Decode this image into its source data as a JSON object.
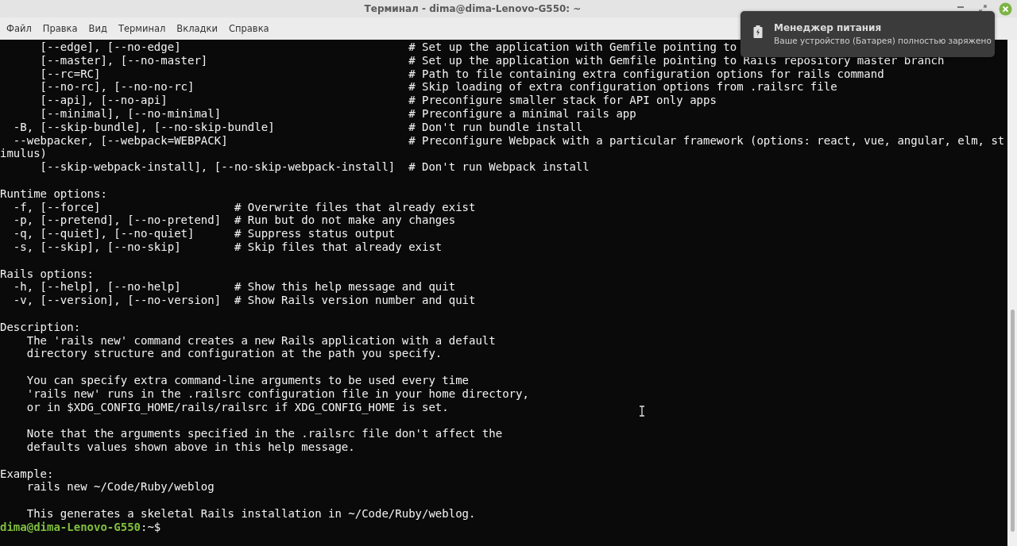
{
  "window": {
    "title": "Терминал - dima@dima-Lenovo-G550: ~"
  },
  "menu": [
    {
      "label": "Файл"
    },
    {
      "label": "Правка"
    },
    {
      "label": "Вид"
    },
    {
      "label": "Терминал"
    },
    {
      "label": "Вкладки"
    },
    {
      "label": "Справка"
    }
  ],
  "terminal": {
    "blocks": [
      {
        "lines": [
          {
            "kind": "option",
            "option": "      [--edge], [--no-edge]",
            "comment": "# Set up the application with Gemfile pointing to"
          },
          {
            "kind": "option",
            "option": "      [--master], [--no-master]",
            "comment": "# Set up the application with Gemfile pointing to Rails repository master branch"
          },
          {
            "kind": "option",
            "option": "      [--rc=RC]",
            "comment": "# Path to file containing extra configuration options for rails command"
          },
          {
            "kind": "option",
            "option": "      [--no-rc], [--no-no-rc]",
            "comment": "# Skip loading of extra configuration options from .railsrc file"
          },
          {
            "kind": "option",
            "option": "      [--api], [--no-api]",
            "comment": "# Preconfigure smaller stack for API only apps"
          },
          {
            "kind": "option",
            "option": "      [--minimal], [--no-minimal]",
            "comment": "# Preconfigure a minimal rails app"
          },
          {
            "kind": "option",
            "option": "  -B, [--skip-bundle], [--no-skip-bundle]",
            "comment": "# Don't run bundle install"
          },
          {
            "kind": "option",
            "option": "  --webpacker, [--webpack=WEBPACK]",
            "comment": "# Preconfigure Webpack with a particular framework (options: react, vue, angular, elm, st"
          },
          {
            "kind": "text",
            "text": "imulus)"
          },
          {
            "kind": "option",
            "option": "      [--skip-webpack-install], [--no-skip-webpack-install]",
            "comment": "# Don't run Webpack install"
          }
        ]
      },
      {
        "lines": [
          {
            "kind": "text",
            "text": "Runtime options:"
          },
          {
            "kind": "option",
            "option": "  -f, [--force]",
            "comment": "# Overwrite files that already exist"
          },
          {
            "kind": "option",
            "option": "  -p, [--pretend], [--no-pretend]",
            "comment": "# Run but do not make any changes"
          },
          {
            "kind": "option",
            "option": "  -q, [--quiet], [--no-quiet]",
            "comment": "# Suppress status output"
          },
          {
            "kind": "option",
            "option": "  -s, [--skip], [--no-skip]",
            "comment": "# Skip files that already exist"
          }
        ]
      },
      {
        "lines": [
          {
            "kind": "text",
            "text": "Rails options:"
          },
          {
            "kind": "option",
            "option": "  -h, [--help], [--no-help]",
            "comment": "# Show this help message and quit"
          },
          {
            "kind": "option",
            "option": "  -v, [--version], [--no-version]",
            "comment": "# Show Rails version number and quit"
          }
        ]
      },
      {
        "lines": [
          {
            "kind": "text",
            "text": "Description:"
          },
          {
            "kind": "text",
            "text": "    The 'rails new' command creates a new Rails application with a default"
          },
          {
            "kind": "text",
            "text": "    directory structure and configuration at the path you specify."
          }
        ]
      },
      {
        "lines": [
          {
            "kind": "text",
            "text": "    You can specify extra command-line arguments to be used every time"
          },
          {
            "kind": "text",
            "text": "    'rails new' runs in the .railsrc configuration file in your home directory,"
          },
          {
            "kind": "text",
            "text": "    or in $XDG_CONFIG_HOME/rails/railsrc if XDG_CONFIG_HOME is set."
          }
        ]
      },
      {
        "lines": [
          {
            "kind": "text",
            "text": "    Note that the arguments specified in the .railsrc file don't affect the"
          },
          {
            "kind": "text",
            "text": "    defaults values shown above in this help message."
          }
        ]
      },
      {
        "lines": [
          {
            "kind": "text",
            "text": "Example:"
          },
          {
            "kind": "text",
            "text": "    rails new ~/Code/Ruby/weblog"
          }
        ]
      },
      {
        "lines": [
          {
            "kind": "text",
            "text": "    This generates a skeletal Rails installation in ~/Code/Ruby/weblog."
          }
        ]
      }
    ],
    "prompt": {
      "user_host": "dima@dima-Lenovo-G550",
      "path": ":~$"
    }
  },
  "notification": {
    "title": "Менеджер питания",
    "body": "Ваше устройство (Батарея) полностью заряжено"
  }
}
